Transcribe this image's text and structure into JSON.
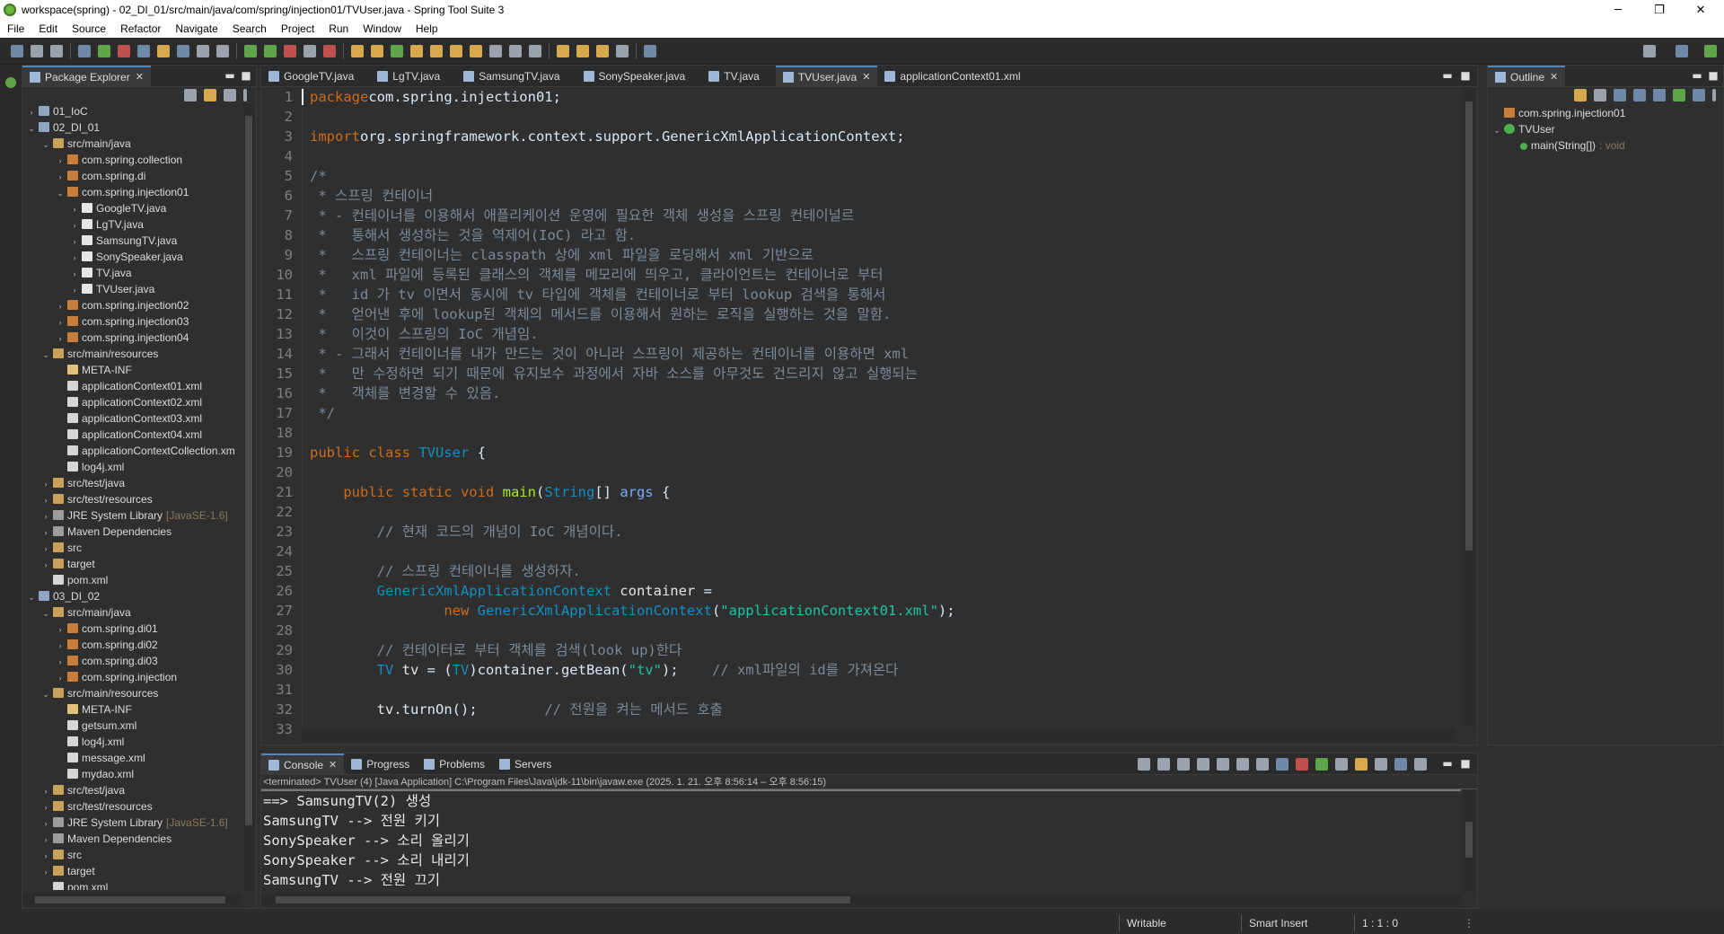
{
  "window": {
    "title": "workspace(spring) - 02_DI_01/src/main/java/com/spring/injection01/TVUser.java - Spring Tool Suite 3"
  },
  "menu": [
    "File",
    "Edit",
    "Source",
    "Refactor",
    "Navigate",
    "Search",
    "Project",
    "Run",
    "Window",
    "Help"
  ],
  "package_explorer": {
    "tab_label": "Package Explorer",
    "tree": [
      {
        "indent": 0,
        "arrow": "›",
        "icon": "proj",
        "label": "01_IoC"
      },
      {
        "indent": 0,
        "arrow": "⌄",
        "icon": "proj",
        "label": "02_DI_01"
      },
      {
        "indent": 1,
        "arrow": "⌄",
        "icon": "fold",
        "label": "src/main/java"
      },
      {
        "indent": 2,
        "arrow": "›",
        "icon": "pkg",
        "label": "com.spring.collection"
      },
      {
        "indent": 2,
        "arrow": "›",
        "icon": "pkg",
        "label": "com.spring.di"
      },
      {
        "indent": 2,
        "arrow": "⌄",
        "icon": "pkg",
        "label": "com.spring.injection01"
      },
      {
        "indent": 3,
        "arrow": "›",
        "icon": "java",
        "label": "GoogleTV.java"
      },
      {
        "indent": 3,
        "arrow": "›",
        "icon": "java",
        "label": "LgTV.java"
      },
      {
        "indent": 3,
        "arrow": "›",
        "icon": "java",
        "label": "SamsungTV.java"
      },
      {
        "indent": 3,
        "arrow": "›",
        "icon": "java",
        "label": "SonySpeaker.java"
      },
      {
        "indent": 3,
        "arrow": "›",
        "icon": "java",
        "label": "TV.java"
      },
      {
        "indent": 3,
        "arrow": "›",
        "icon": "java",
        "label": "TVUser.java"
      },
      {
        "indent": 2,
        "arrow": "›",
        "icon": "pkg",
        "label": "com.spring.injection02"
      },
      {
        "indent": 2,
        "arrow": "›",
        "icon": "pkg",
        "label": "com.spring.injection03"
      },
      {
        "indent": 2,
        "arrow": "›",
        "icon": "pkg",
        "label": "com.spring.injection04"
      },
      {
        "indent": 1,
        "arrow": "⌄",
        "icon": "fold",
        "label": "src/main/resources"
      },
      {
        "indent": 2,
        "arrow": "",
        "icon": "meta",
        "label": "META-INF"
      },
      {
        "indent": 2,
        "arrow": "",
        "icon": "xml",
        "label": "applicationContext01.xml"
      },
      {
        "indent": 2,
        "arrow": "",
        "icon": "xml",
        "label": "applicationContext02.xml"
      },
      {
        "indent": 2,
        "arrow": "",
        "icon": "xml",
        "label": "applicationContext03.xml"
      },
      {
        "indent": 2,
        "arrow": "",
        "icon": "xml",
        "label": "applicationContext04.xml"
      },
      {
        "indent": 2,
        "arrow": "",
        "icon": "xml",
        "label": "applicationContextCollection.xm"
      },
      {
        "indent": 2,
        "arrow": "",
        "icon": "xml",
        "label": "log4j.xml"
      },
      {
        "indent": 1,
        "arrow": "›",
        "icon": "fold",
        "label": "src/test/java"
      },
      {
        "indent": 1,
        "arrow": "›",
        "icon": "fold",
        "label": "src/test/resources"
      },
      {
        "indent": 1,
        "arrow": "›",
        "icon": "lib",
        "label": "JRE System Library",
        "decoration": "[JavaSE-1.6]"
      },
      {
        "indent": 1,
        "arrow": "›",
        "icon": "lib",
        "label": "Maven Dependencies"
      },
      {
        "indent": 1,
        "arrow": "›",
        "icon": "fold",
        "label": "src"
      },
      {
        "indent": 1,
        "arrow": "›",
        "icon": "fold",
        "label": "target"
      },
      {
        "indent": 1,
        "arrow": "",
        "icon": "xml",
        "label": "pom.xml"
      },
      {
        "indent": 0,
        "arrow": "⌄",
        "icon": "proj",
        "label": "03_DI_02"
      },
      {
        "indent": 1,
        "arrow": "⌄",
        "icon": "fold",
        "label": "src/main/java"
      },
      {
        "indent": 2,
        "arrow": "›",
        "icon": "pkg",
        "label": "com.spring.di01"
      },
      {
        "indent": 2,
        "arrow": "›",
        "icon": "pkg",
        "label": "com.spring.di02"
      },
      {
        "indent": 2,
        "arrow": "›",
        "icon": "pkg",
        "label": "com.spring.di03"
      },
      {
        "indent": 2,
        "arrow": "›",
        "icon": "pkg",
        "label": "com.spring.injection"
      },
      {
        "indent": 1,
        "arrow": "⌄",
        "icon": "fold",
        "label": "src/main/resources"
      },
      {
        "indent": 2,
        "arrow": "",
        "icon": "meta",
        "label": "META-INF"
      },
      {
        "indent": 2,
        "arrow": "",
        "icon": "xml",
        "label": "getsum.xml"
      },
      {
        "indent": 2,
        "arrow": "",
        "icon": "xml",
        "label": "log4j.xml"
      },
      {
        "indent": 2,
        "arrow": "",
        "icon": "xml",
        "label": "message.xml"
      },
      {
        "indent": 2,
        "arrow": "",
        "icon": "xml",
        "label": "mydao.xml"
      },
      {
        "indent": 1,
        "arrow": "›",
        "icon": "fold",
        "label": "src/test/java"
      },
      {
        "indent": 1,
        "arrow": "›",
        "icon": "fold",
        "label": "src/test/resources"
      },
      {
        "indent": 1,
        "arrow": "›",
        "icon": "lib",
        "label": "JRE System Library",
        "decoration": "[JavaSE-1.6]"
      },
      {
        "indent": 1,
        "arrow": "›",
        "icon": "lib",
        "label": "Maven Dependencies"
      },
      {
        "indent": 1,
        "arrow": "›",
        "icon": "fold",
        "label": "src"
      },
      {
        "indent": 1,
        "arrow": "›",
        "icon": "fold",
        "label": "target"
      },
      {
        "indent": 1,
        "arrow": "",
        "icon": "xml",
        "label": "pom.xml"
      }
    ]
  },
  "editor": {
    "tabs": [
      {
        "label": "GoogleTV.java",
        "active": false
      },
      {
        "label": "LgTV.java",
        "active": false
      },
      {
        "label": "SamsungTV.java",
        "active": false
      },
      {
        "label": "SonySpeaker.java",
        "active": false
      },
      {
        "label": "TV.java",
        "active": false
      },
      {
        "label": "TVUser.java",
        "active": true
      },
      {
        "label": "applicationContext01.xml",
        "active": false
      }
    ],
    "line_numbers": [
      "1",
      "2",
      "3",
      "4",
      "5",
      "6",
      "7",
      "8",
      "9",
      "10",
      "11",
      "12",
      "13",
      "14",
      "15",
      "16",
      "17",
      "18",
      "19",
      "20",
      "21",
      "22",
      "23",
      "24",
      "25",
      "26",
      "27",
      "28",
      "29",
      "30",
      "31",
      "32",
      "33"
    ],
    "fold_markers": [
      "5",
      "21"
    ],
    "lines": [
      [
        [
          "k",
          "package"
        ],
        [
          "",
          "com.spring.injection01;"
        ]
      ],
      [],
      [
        [
          "k",
          "import"
        ],
        [
          "",
          "org.springframework.context.support.GenericXmlApplicationContext;"
        ]
      ],
      [],
      [
        [
          "cm",
          "/*"
        ]
      ],
      [
        [
          "cm",
          " * 스프링 컨테이너"
        ]
      ],
      [
        [
          "cm",
          " * - 컨테이너를 이용해서 애플리케이션 운영에 필요한 객체 생성을 스프링 컨테이널르"
        ]
      ],
      [
        [
          "cm",
          " *   통해서 생성하는 것을 역제어(IoC) 라고 함."
        ]
      ],
      [
        [
          "cm",
          " *   스프링 컨테이너는 classpath 상에 xml 파일을 로딩해서 xml 기반으로"
        ]
      ],
      [
        [
          "cm",
          " *   xml 파일에 등록된 클래스의 객체를 메모리에 띄우고, 클라이언트는 컨테이너로 부터"
        ]
      ],
      [
        [
          "cm",
          " *   id 가 tv 이면서 동시에 tv 타입에 객체를 컨테이너로 부터 lookup 검색을 통해서"
        ]
      ],
      [
        [
          "cm",
          " *   얻어낸 후에 lookup된 객체의 메서드를 이용해서 원하는 로직을 실행하는 것을 말함."
        ]
      ],
      [
        [
          "cm",
          " *   이것이 스프링의 IoC 개념임."
        ]
      ],
      [
        [
          "cm",
          " * - 그래서 컨테이너를 내가 만드는 것이 아니라 스프링이 제공하는 컨테이너를 이용하면 xml"
        ]
      ],
      [
        [
          "cm",
          " *   만 수정하면 되기 때문에 유지보수 과정에서 자바 소스를 아무것도 건드리지 않고 실행되는"
        ]
      ],
      [
        [
          "cm",
          " *   객체를 변경할 수 있음."
        ]
      ],
      [
        [
          "cm",
          " */"
        ]
      ],
      [],
      [
        [
          "k",
          "public class "
        ],
        [
          "t",
          "TVUser"
        ],
        [
          "",
          " {"
        ]
      ],
      [],
      [
        [
          "",
          "    "
        ],
        [
          "k",
          "public static void "
        ],
        [
          "fn",
          "main"
        ],
        [
          "",
          "("
        ],
        [
          "t",
          "String"
        ],
        [
          "",
          "[] "
        ],
        [
          "v",
          "args"
        ],
        [
          "",
          " {"
        ]
      ],
      [],
      [
        [
          "",
          "        "
        ],
        [
          "cm",
          "// 현재 코드의 개념이 IoC 개념이다."
        ]
      ],
      [],
      [
        [
          "",
          "        "
        ],
        [
          "cm",
          "// 스프링 컨테이너를 생성하자."
        ]
      ],
      [
        [
          "",
          "        "
        ],
        [
          "t",
          "GenericXmlApplicationContext "
        ],
        [
          "cu",
          "container"
        ],
        [
          "",
          " ="
        ]
      ],
      [
        [
          "",
          "                "
        ],
        [
          "k",
          "new "
        ],
        [
          "t",
          "GenericXmlApplicationContext"
        ],
        [
          "",
          "("
        ],
        [
          "s",
          "\"applicationContext01.xml\""
        ],
        [
          "",
          ");"
        ]
      ],
      [],
      [
        [
          "",
          "        "
        ],
        [
          "cm",
          "// 컨테이터로 부터 객체를 검색(look up)한다"
        ]
      ],
      [
        [
          "",
          "        "
        ],
        [
          "t",
          "TV "
        ],
        [
          "cu",
          "tv"
        ],
        [
          "",
          " = ("
        ],
        [
          "t",
          "TV"
        ],
        [
          "",
          ")container.getBean("
        ],
        [
          "s",
          "\"tv\""
        ],
        [
          "",
          ");    "
        ],
        [
          "cm",
          "// xml파일의 id를 가져온다"
        ]
      ],
      [],
      [
        [
          "",
          "        "
        ],
        [
          "cu",
          "tv"
        ],
        [
          "",
          ".turnOn();        "
        ],
        [
          "cm",
          "// 전원을 켜는 메서드 호출"
        ]
      ],
      [
        [
          "",
          ""
        ]
      ]
    ]
  },
  "outline": {
    "tab_label": "Outline",
    "items": [
      {
        "indent": 0,
        "arrow": "",
        "icon": "pkg",
        "label": "com.spring.injection01"
      },
      {
        "indent": 0,
        "arrow": "⌄",
        "icon": "class",
        "label": "TVUser"
      },
      {
        "indent": 1,
        "arrow": "",
        "icon": "method",
        "label": "main(String[])",
        "decoration": ": void"
      }
    ]
  },
  "bottom_panel": {
    "tabs": [
      {
        "label": "Console",
        "active": true
      },
      {
        "label": "Progress",
        "active": false
      },
      {
        "label": "Problems",
        "active": false
      },
      {
        "label": "Servers",
        "active": false
      }
    ],
    "status_line": "<terminated> TVUser (4) [Java Application] C:\\Program Files\\Java\\jdk-11\\bin\\javaw.exe  (2025. 1. 21. 오후 8:56:14 – 오후 8:56:15)",
    "output": [
      "==> SamsungTV(2) 생성",
      "SamsungTV --> 전원 키기",
      "SonySpeaker --> 소리 올리기",
      "SonySpeaker --> 소리 내리기",
      "SamsungTV --> 전원 끄기"
    ]
  },
  "status_bar": {
    "writable": "Writable",
    "insert_mode": "Smart Insert",
    "position": "1 : 1 : 0"
  }
}
